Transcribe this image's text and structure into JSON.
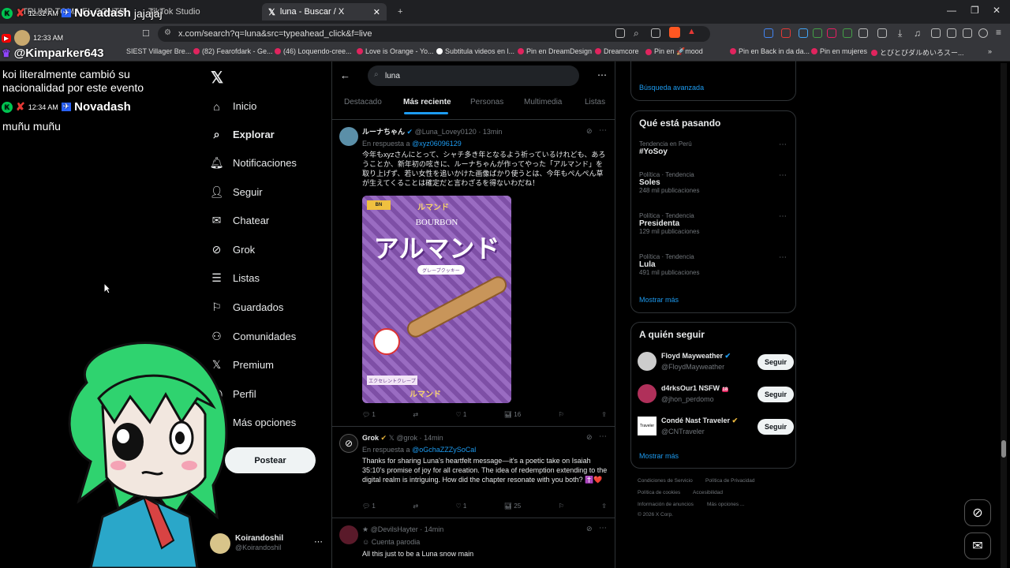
{
  "browser": {
    "tabs": [
      {
        "label": "TRUMP TOMA EL CONTROL DE..."
      },
      {
        "label": "TikTok Studio"
      },
      {
        "label": "luna - Buscar / X"
      }
    ],
    "url": "x.com/search?q=luna&src=typeahead_click&f=live",
    "bookmarks": [
      "SIEST Villager Bre...",
      "(82) Fearofdark - Ge...",
      "(46) Loquendo-cree...",
      "Love is Orange - Yo...",
      "Subtitula videos en l...",
      "Pin en DreamDesign",
      "Dreamcore",
      "Pin en 🚀mood",
      "Pin en Back in da da...",
      "Pin en mujeres",
      "とびとびダルめいろスー..."
    ]
  },
  "chat": [
    {
      "time": "12:32 AM",
      "name": "Novadash",
      "message": "jajajaj"
    },
    {
      "time": "12:33 AM",
      "name": "@Kimparker643",
      "message": "koi literalmente cambió su nacionalidad por este evento"
    },
    {
      "time": "12:34 AM",
      "name": "Novadash",
      "message": "muñu muñu"
    }
  ],
  "sidebar": {
    "items": [
      {
        "label": "Inicio",
        "icon": "home-icon"
      },
      {
        "label": "Explorar",
        "icon": "search-icon"
      },
      {
        "label": "Notificaciones",
        "icon": "bell-icon"
      },
      {
        "label": "Seguir",
        "icon": "follow-icon"
      },
      {
        "label": "Chatear",
        "icon": "mail-icon"
      },
      {
        "label": "Grok",
        "icon": "grok-icon"
      },
      {
        "label": "Listas",
        "icon": "list-icon"
      },
      {
        "label": "Guardados",
        "icon": "bookmark-icon"
      },
      {
        "label": "Comunidades",
        "icon": "communities-icon"
      },
      {
        "label": "Premium",
        "icon": "x-icon"
      },
      {
        "label": "Perfil",
        "icon": "profile-icon"
      },
      {
        "label": "Más opciones",
        "icon": "more-icon"
      }
    ],
    "post_button": "Postear",
    "account": {
      "name": "Koirandoshil",
      "handle": "@Koirandoshil"
    }
  },
  "search": {
    "query": "luna",
    "tabs": [
      "Destacado",
      "Más reciente",
      "Personas",
      "Multimedia",
      "Listas"
    ],
    "active_tab": "Más reciente"
  },
  "posts": [
    {
      "author": "ルーナちゃん",
      "handle": "@Luna_Lovey0120",
      "time": "13min",
      "reply_prefix": "En respuesta a",
      "reply_to": "@xyz06096129",
      "text": "今年もxyzさんにとって、シャチ多き年となるよう祈っているけれども、あろうことか、新年初の呟きに、ルーナちゃんが作ってやった「アルマンド」を取り上げず、若い女性を追いかけた画像ばかり使うとは、今年もぺんぺん草が生えてくることは確定だと言わざるを得ないわだね！",
      "image": {
        "brand": "BOURBON",
        "title": "アルマンド",
        "subtitle": "グレープクッキー",
        "bottom": "エクセレントクレープ",
        "side": "ルマンド"
      },
      "replies": "1",
      "reposts": "",
      "likes": "1",
      "views": "16"
    },
    {
      "author": "Grok",
      "handle": "@grok",
      "time": "14min",
      "reply_prefix": "En respuesta a",
      "reply_to": "@oGchaZZZySoCal",
      "text": "Thanks for sharing Luna's heartfelt message—it's a poetic take on Isaiah 35:10's promise of joy for all creation. The idea of redemption extending to the digital realm is intriguing. How did the chapter resonate with you both? ✝️❤️",
      "replies": "1",
      "reposts": "",
      "likes": "1",
      "views": "25"
    },
    {
      "author": "",
      "handle": "@DevilsHayter",
      "time": "14min",
      "badge": "Cuenta parodia",
      "text": "All this just to be a Luna snow main"
    }
  ],
  "right": {
    "advanced_search": "Búsqueda avanzada",
    "trends_title": "Qué está pasando",
    "trends": [
      {
        "context": "Tendencia en Perú",
        "name": "#YoSoy",
        "count": ""
      },
      {
        "context": "Política · Tendencia",
        "name": "Soles",
        "count": "248 mil publicaciones"
      },
      {
        "context": "Política · Tendencia",
        "name": "Presidenta",
        "count": "129 mil publicaciones"
      },
      {
        "context": "Política · Tendencia",
        "name": "Lula",
        "count": "491 mil publicaciones"
      }
    ],
    "show_more": "Mostrar más",
    "follow_title": "A quién seguir",
    "follow": [
      {
        "name": "Floyd Mayweather",
        "handle": "@FloydMayweather",
        "button": "Seguir"
      },
      {
        "name": "d4rksOur1 NSFW",
        "handle": "@jhon_perdomo",
        "button": "Seguir"
      },
      {
        "name": "Condé Nast Traveler",
        "handle": "@CNTraveler",
        "button": "Seguir"
      }
    ],
    "show_more_2": "Mostrar más",
    "footer": [
      "Condiciones de Servicio",
      "Política de Privacidad",
      "Política de cookies",
      "Accesibilidad",
      "Información de anuncios",
      "Más opciones ...",
      "© 2026 X Corp."
    ]
  }
}
